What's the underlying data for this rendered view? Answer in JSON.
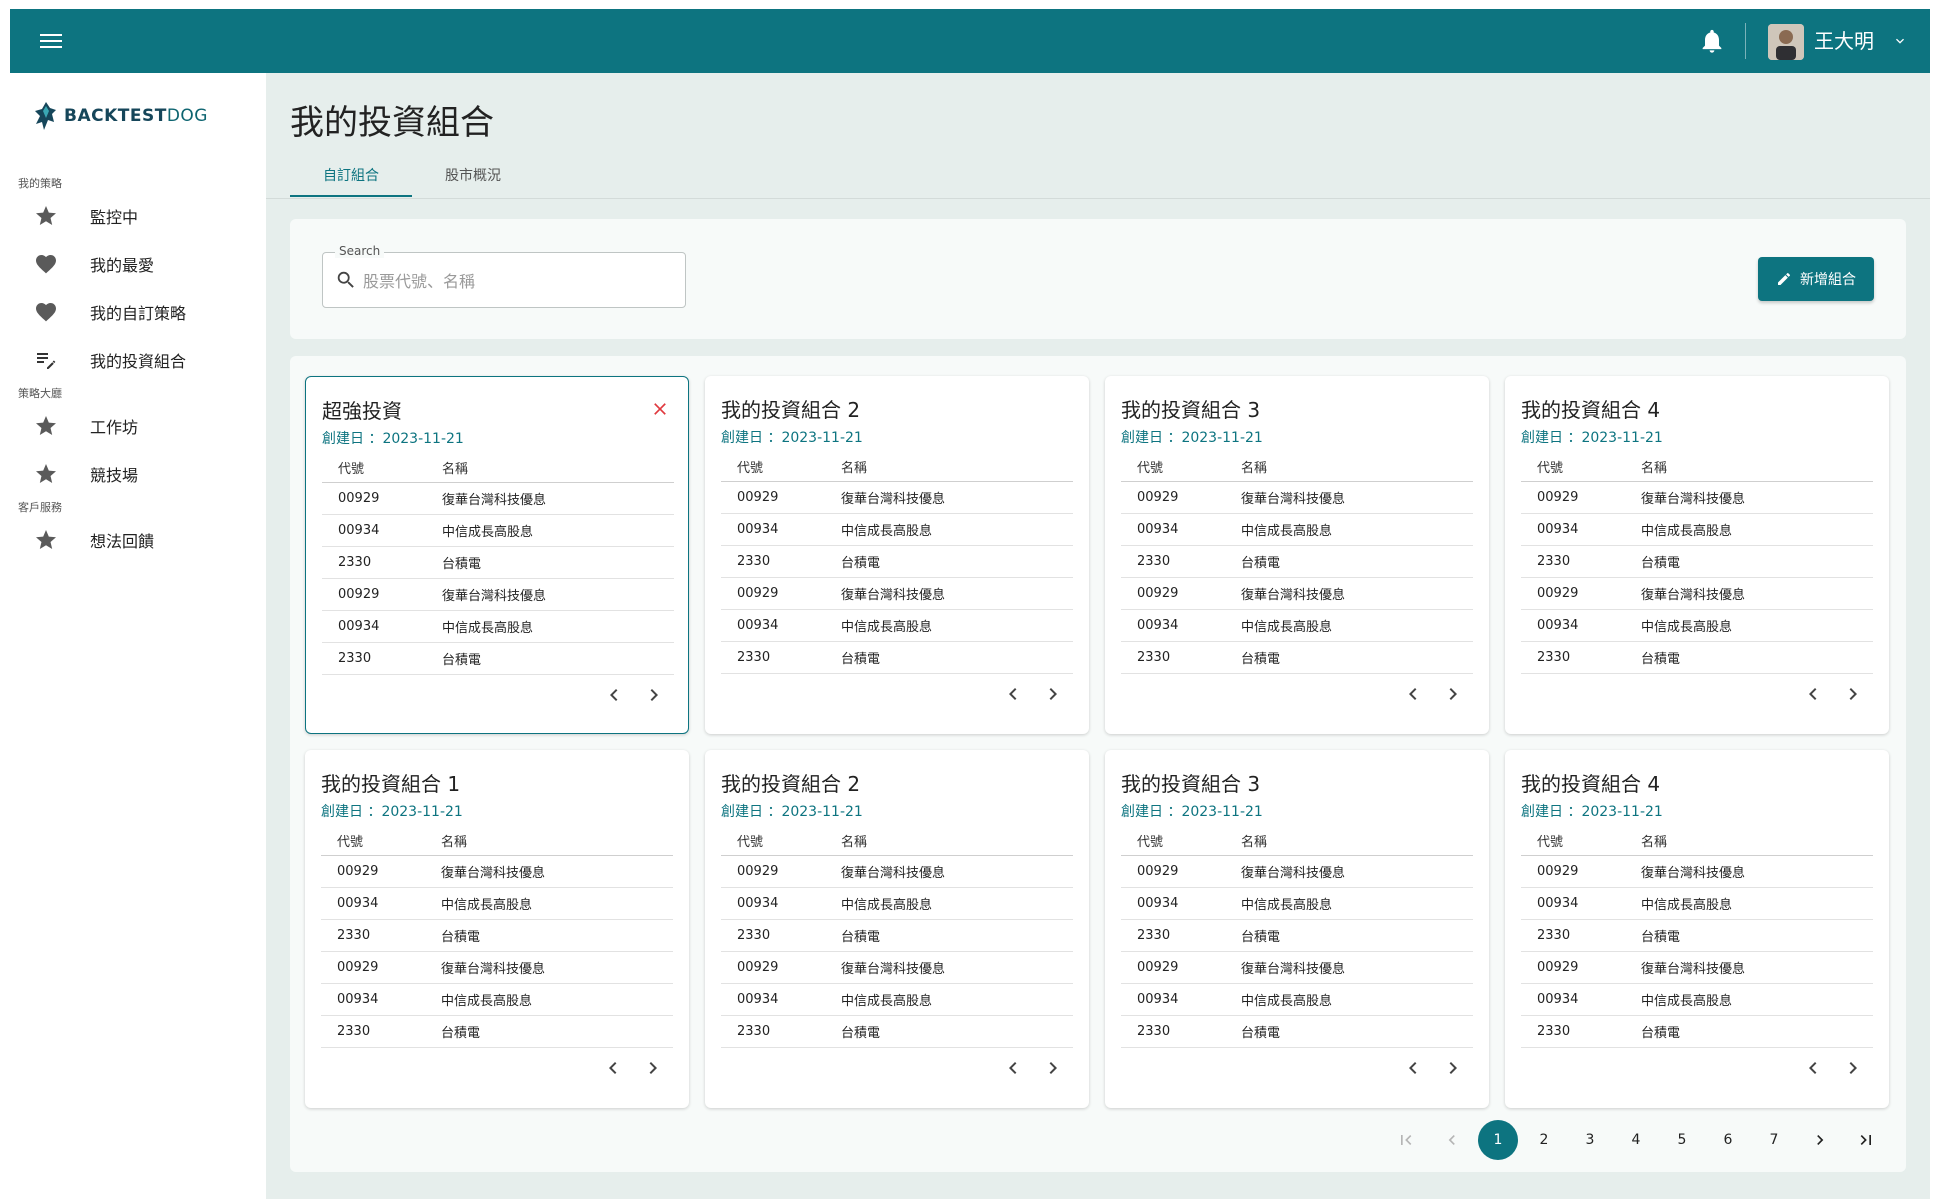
{
  "header": {
    "user_name": "王大明",
    "icons": {
      "menu": "menu-icon",
      "bell": "bell-icon",
      "caret": "chevron-down-icon"
    }
  },
  "sidebar": {
    "logo": {
      "prefix": "BACKTEST",
      "suffix": "DOG"
    },
    "sections": [
      {
        "label": "我的策略",
        "items": [
          {
            "label": "監控中",
            "icon": "star-icon"
          },
          {
            "label": "我的最愛",
            "icon": "heart-icon"
          },
          {
            "label": "我的自訂策略",
            "icon": "heart-icon"
          },
          {
            "label": "我的投資組合",
            "icon": "playlist-edit-icon"
          }
        ]
      },
      {
        "label": "策略大廳",
        "items": [
          {
            "label": "工作坊",
            "icon": "star-icon"
          },
          {
            "label": "競技場",
            "icon": "star-icon"
          }
        ]
      },
      {
        "label": "客戶服務",
        "items": [
          {
            "label": "想法回饋",
            "icon": "star-icon"
          }
        ]
      }
    ]
  },
  "main": {
    "title": "我的投資組合",
    "tabs": [
      {
        "label": "自訂組合",
        "active": true
      },
      {
        "label": "股市概況",
        "active": false
      }
    ],
    "search": {
      "legend": "Search",
      "placeholder": "股票代號、名稱",
      "value": ""
    },
    "add_button": {
      "label": "新增組合"
    },
    "table_headers": {
      "code": "代號",
      "name": "名稱"
    },
    "cards": [
      {
        "title": "超強投資",
        "date_label": "創建日 ：2023-11-21",
        "selected": true,
        "closable": true,
        "rows": [
          [
            "00929",
            "復華台灣科技優息"
          ],
          [
            "00934",
            "中信成長高股息"
          ],
          [
            "2330",
            "台積電"
          ],
          [
            "00929",
            "復華台灣科技優息"
          ],
          [
            "00934",
            "中信成長高股息"
          ],
          [
            "2330",
            "台積電"
          ]
        ]
      },
      {
        "title": "我的投資組合 2",
        "date_label": "創建日 ：2023-11-21",
        "selected": false,
        "closable": false,
        "rows": [
          [
            "00929",
            "復華台灣科技優息"
          ],
          [
            "00934",
            "中信成長高股息"
          ],
          [
            "2330",
            "台積電"
          ],
          [
            "00929",
            "復華台灣科技優息"
          ],
          [
            "00934",
            "中信成長高股息"
          ],
          [
            "2330",
            "台積電"
          ]
        ]
      },
      {
        "title": "我的投資組合 3",
        "date_label": "創建日 ：2023-11-21",
        "selected": false,
        "closable": false,
        "rows": [
          [
            "00929",
            "復華台灣科技優息"
          ],
          [
            "00934",
            "中信成長高股息"
          ],
          [
            "2330",
            "台積電"
          ],
          [
            "00929",
            "復華台灣科技優息"
          ],
          [
            "00934",
            "中信成長高股息"
          ],
          [
            "2330",
            "台積電"
          ]
        ]
      },
      {
        "title": "我的投資組合 4",
        "date_label": "創建日 ：2023-11-21",
        "selected": false,
        "closable": false,
        "rows": [
          [
            "00929",
            "復華台灣科技優息"
          ],
          [
            "00934",
            "中信成長高股息"
          ],
          [
            "2330",
            "台積電"
          ],
          [
            "00929",
            "復華台灣科技優息"
          ],
          [
            "00934",
            "中信成長高股息"
          ],
          [
            "2330",
            "台積電"
          ]
        ]
      },
      {
        "title": "我的投資組合 1",
        "date_label": "創建日 ：2023-11-21",
        "selected": false,
        "closable": false,
        "rows": [
          [
            "00929",
            "復華台灣科技優息"
          ],
          [
            "00934",
            "中信成長高股息"
          ],
          [
            "2330",
            "台積電"
          ],
          [
            "00929",
            "復華台灣科技優息"
          ],
          [
            "00934",
            "中信成長高股息"
          ],
          [
            "2330",
            "台積電"
          ]
        ]
      },
      {
        "title": "我的投資組合 2",
        "date_label": "創建日 ：2023-11-21",
        "selected": false,
        "closable": false,
        "rows": [
          [
            "00929",
            "復華台灣科技優息"
          ],
          [
            "00934",
            "中信成長高股息"
          ],
          [
            "2330",
            "台積電"
          ],
          [
            "00929",
            "復華台灣科技優息"
          ],
          [
            "00934",
            "中信成長高股息"
          ],
          [
            "2330",
            "台積電"
          ]
        ]
      },
      {
        "title": "我的投資組合 3",
        "date_label": "創建日 ：2023-11-21",
        "selected": false,
        "closable": false,
        "rows": [
          [
            "00929",
            "復華台灣科技優息"
          ],
          [
            "00934",
            "中信成長高股息"
          ],
          [
            "2330",
            "台積電"
          ],
          [
            "00929",
            "復華台灣科技優息"
          ],
          [
            "00934",
            "中信成長高股息"
          ],
          [
            "2330",
            "台積電"
          ]
        ]
      },
      {
        "title": "我的投資組合 4",
        "date_label": "創建日 ：2023-11-21",
        "selected": false,
        "closable": false,
        "rows": [
          [
            "00929",
            "復華台灣科技優息"
          ],
          [
            "00934",
            "中信成長高股息"
          ],
          [
            "2330",
            "台積電"
          ],
          [
            "00929",
            "復華台灣科技優息"
          ],
          [
            "00934",
            "中信成長高股息"
          ],
          [
            "2330",
            "台積電"
          ]
        ]
      }
    ],
    "pagination": {
      "pages": [
        "1",
        "2",
        "3",
        "4",
        "5",
        "6",
        "7"
      ],
      "current": "1"
    }
  },
  "colors": {
    "primary": "#0d7480",
    "danger": "#e0393e",
    "background": "#e6eeec"
  }
}
